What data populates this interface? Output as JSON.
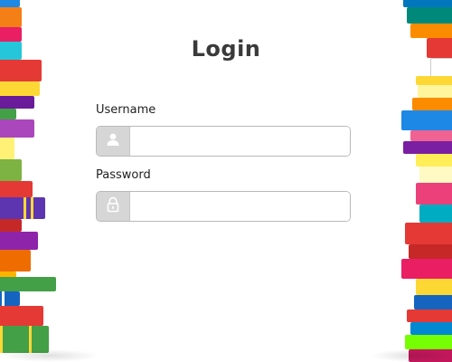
{
  "login": {
    "title": "Login",
    "username": {
      "label": "Username",
      "value": "",
      "placeholder": "",
      "icon": "user-icon"
    },
    "password": {
      "label": "Password",
      "value": "",
      "placeholder": "",
      "icon": "lock-icon"
    }
  },
  "colors": {
    "title": "#3a3a3a",
    "addon_bg": "#d6d6d6",
    "field_border": "#b9b9b9"
  }
}
